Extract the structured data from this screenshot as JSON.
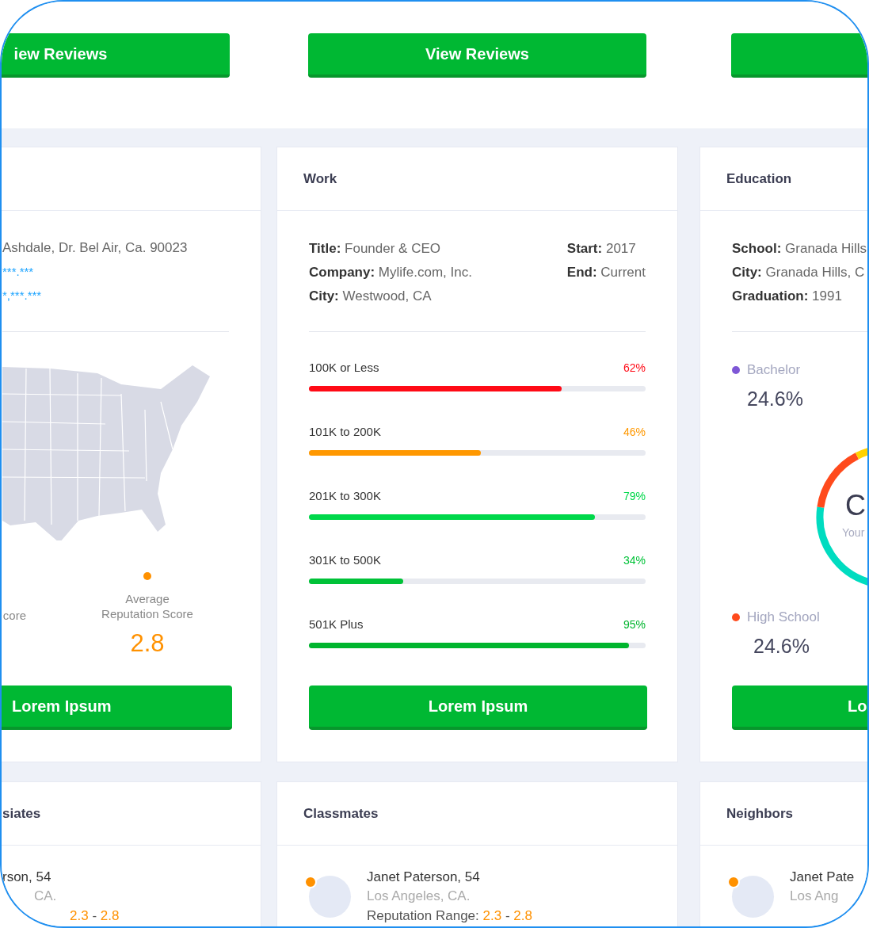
{
  "top_buttons": [
    {
      "kind": "labeled",
      "label": "iew Reviews"
    },
    {
      "kind": "labeled",
      "label": "View Reviews"
    },
    {
      "kind": "blank"
    }
  ],
  "profile": {
    "address": "Ashdale, Dr. Bel Air, Ca. 90023",
    "masked": [
      "***.***",
      "*,***.***"
    ],
    "legend": [
      {
        "label": "core"
      },
      {
        "label": "Average Reputation Score",
        "value": "2.8",
        "color": "#ff9100"
      }
    ],
    "button": "Lorem Ipsum"
  },
  "work": {
    "title": "Work",
    "details_left": [
      {
        "label": "Title:",
        "value": "Founder & CEO"
      },
      {
        "label": "Company:",
        "value": "Mylife.com, Inc."
      },
      {
        "label": "City:",
        "value": "Westwood, CA"
      }
    ],
    "details_right": [
      {
        "label": "Start:",
        "value": "2017"
      },
      {
        "label": "End:",
        "value": "Current"
      }
    ],
    "brackets": [
      {
        "label": "100K or Less",
        "percent": "62%",
        "level": 0.75,
        "color": "#ff0a16"
      },
      {
        "label": "101K to 200K",
        "percent": "46%",
        "level": 0.51,
        "color": "#ff9800"
      },
      {
        "label": "201K to 300K",
        "percent": "79%",
        "level": 0.85,
        "color": "#00d84a"
      },
      {
        "label": "301K to 500K",
        "percent": "34%",
        "level": 0.28,
        "color": "#00c238"
      },
      {
        "label": "501K Plus",
        "percent": "95%",
        "level": 0.95,
        "color": "#00b52e"
      }
    ],
    "button": "Lorem Ipsum"
  },
  "education": {
    "title": "Education",
    "details": [
      {
        "label": "School:",
        "value": "Granada Hills"
      },
      {
        "label": "City:",
        "value": "Granada Hills, C"
      },
      {
        "label": "Graduation:",
        "value": "1991"
      }
    ],
    "legend": [
      {
        "label": "Bachelor",
        "value": "24.6%",
        "color": "#7e57d6"
      },
      {
        "label": "High School",
        "value": "24.6%",
        "color": "#ff4a1c"
      }
    ],
    "donut_center": {
      "value": "C",
      "caption": "Your"
    },
    "button": "Lo"
  },
  "people_cards": [
    {
      "title": "siates",
      "person": {
        "avatar": false,
        "name": "rson, 54",
        "location": "CA.",
        "range_low": "2.3",
        "range_sep": "-",
        "range_high": "2.8"
      }
    },
    {
      "title": "Classmates",
      "person": {
        "avatar": true,
        "color": "#ff9100",
        "name": "Janet Paterson, 54",
        "location": "Los Angeles, CA.",
        "range_label": "Reputation Range:",
        "range_low": "2.3",
        "range_sep": "-",
        "range_high": "2.8"
      }
    },
    {
      "title": "Neighbors",
      "person": {
        "avatar": true,
        "color": "#ff9100",
        "name": "Janet Pate",
        "location": "Los Ang"
      }
    }
  ]
}
